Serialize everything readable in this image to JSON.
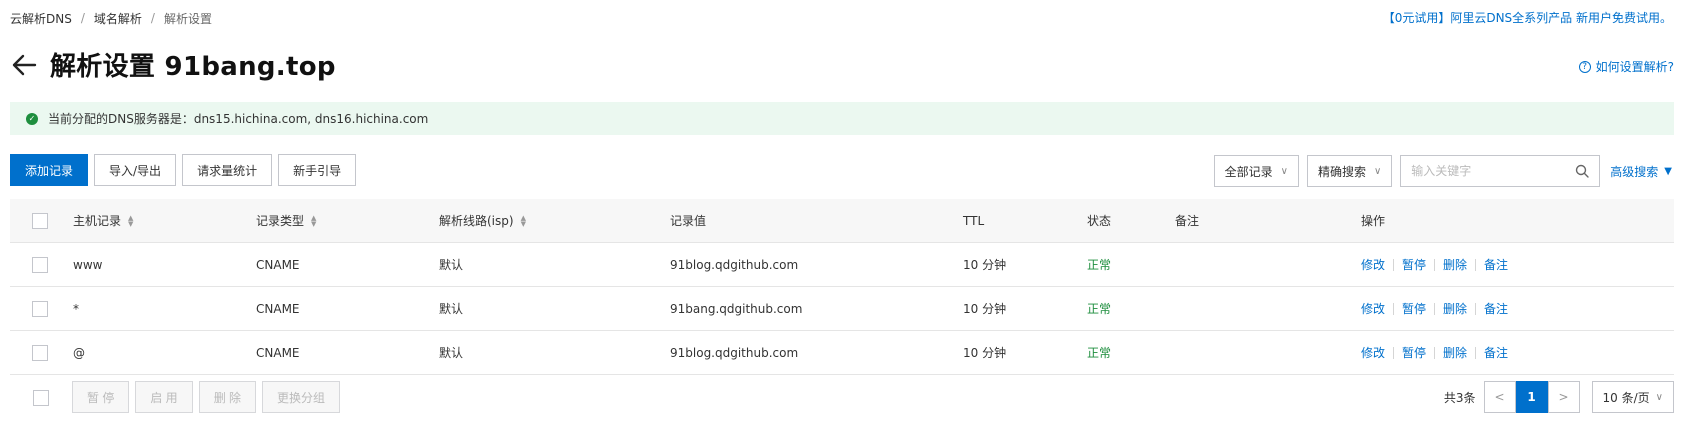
{
  "breadcrumb": [
    "云解析DNS",
    "域名解析",
    "解析设置"
  ],
  "promo": "【0元试用】阿里云DNS全系列产品 新用户免费试用。",
  "title": "解析设置 91bang.top",
  "help": "如何设置解析?",
  "notice": "当前分配的DNS服务器是：dns15.hichina.com, dns16.hichina.com",
  "toolbar": {
    "add": "添加记录",
    "import_export": "导入/导出",
    "stats": "请求量统计",
    "guide": "新手引导",
    "filter_records": "全部记录",
    "search_mode": "精确搜索",
    "search_placeholder": "输入关键字",
    "advanced": "高级搜索"
  },
  "columns": {
    "host": "主机记录",
    "type": "记录类型",
    "line": "解析线路(isp)",
    "value": "记录值",
    "ttl": "TTL",
    "status": "状态",
    "remark": "备注",
    "actions": "操作"
  },
  "rows": [
    {
      "host": "www",
      "type": "CNAME",
      "line": "默认",
      "value": "91blog.qdgithub.com",
      "ttl": "10 分钟",
      "status": "正常"
    },
    {
      "host": "*",
      "type": "CNAME",
      "line": "默认",
      "value": "91bang.qdgithub.com",
      "ttl": "10 分钟",
      "status": "正常"
    },
    {
      "host": "@",
      "type": "CNAME",
      "line": "默认",
      "value": "91blog.qdgithub.com",
      "ttl": "10 分钟",
      "status": "正常"
    }
  ],
  "row_actions": {
    "edit": "修改",
    "pause": "暂停",
    "delete": "删除",
    "remark": "备注"
  },
  "bulk": {
    "pause": "暂 停",
    "enable": "启 用",
    "delete": "删 除",
    "group": "更换分组"
  },
  "pagination": {
    "total": "共3条",
    "current": "1",
    "page_size": "10 条/页"
  },
  "colors": {
    "primary": "#0070cc",
    "success": "#1e8e3e",
    "notice_bg": "#ebf8f0"
  }
}
